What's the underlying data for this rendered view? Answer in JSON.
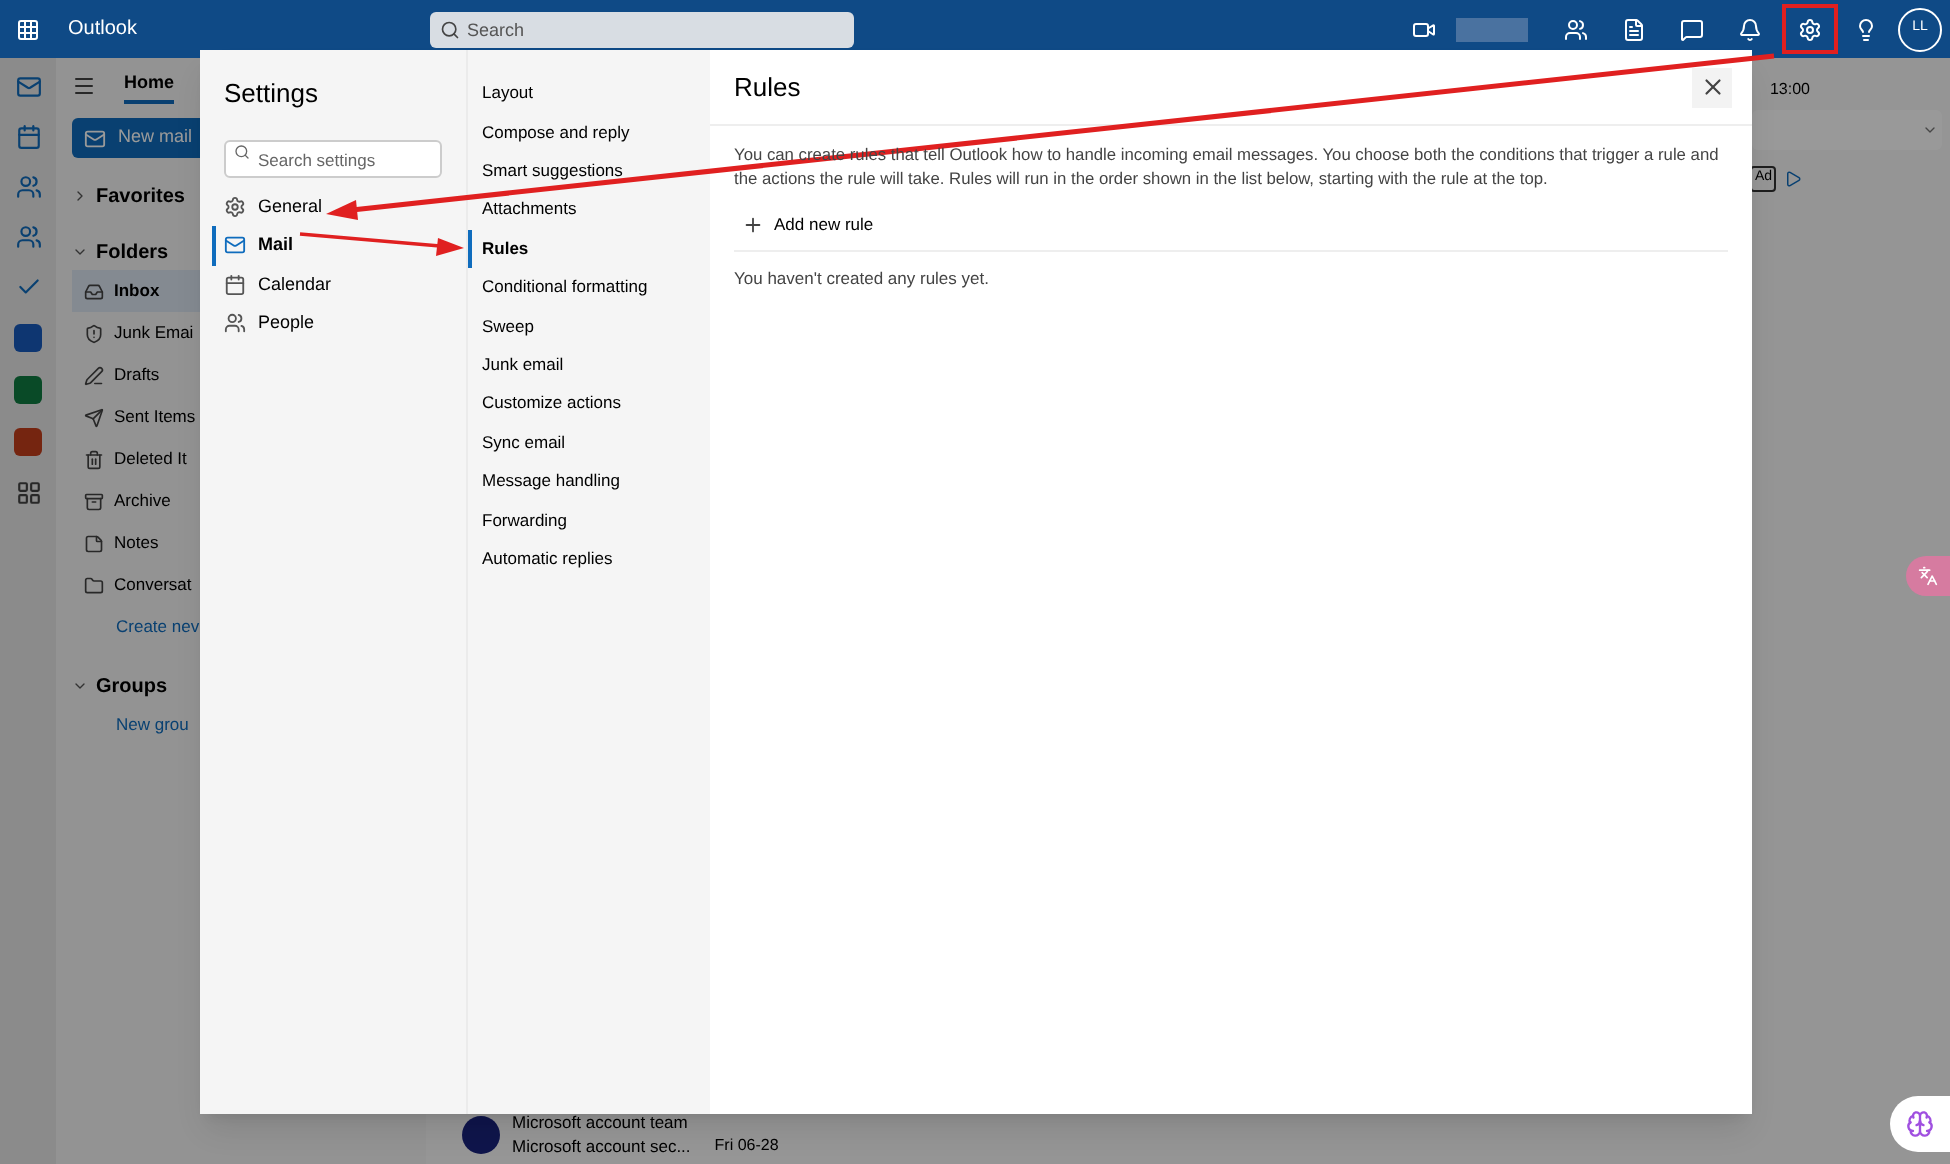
{
  "top_bar": {
    "app_name": "Outlook",
    "search": {
      "placeholder": "Search"
    },
    "avatar": "LL"
  },
  "ribbon": {
    "tabs": [
      {
        "label": "Home",
        "selected": true
      }
    ],
    "new_mail": "New mail"
  },
  "folder_pane": {
    "sections": [
      {
        "label": "Favorites",
        "expanded": false
      },
      {
        "label": "Folders",
        "expanded": true,
        "items": [
          {
            "label": "Inbox",
            "kind": "folder",
            "selected": true
          },
          {
            "label": "Junk Emai",
            "kind": "folder",
            "selected": false
          },
          {
            "label": "Drafts",
            "kind": "folder",
            "selected": false
          },
          {
            "label": "Sent Items",
            "kind": "folder",
            "selected": false
          },
          {
            "label": "Deleted It",
            "kind": "folder",
            "selected": false
          },
          {
            "label": "Archive",
            "kind": "folder",
            "selected": false
          },
          {
            "label": "Notes",
            "kind": "folder",
            "selected": false
          },
          {
            "label": "Conversat",
            "kind": "folder",
            "selected": false
          },
          {
            "label": "Create nev",
            "kind": "link"
          }
        ]
      },
      {
        "label": "Groups",
        "expanded": true,
        "items": [
          {
            "label": "New grou",
            "kind": "link"
          }
        ]
      }
    ]
  },
  "message_list": [
    {
      "sender": "Microsoft account team",
      "subject": "Microsoft account sec...",
      "date": "Fri 06-28"
    }
  ],
  "reading_pane": {
    "time": "13:00",
    "ad_badge": "Ad"
  },
  "settings": {
    "title": "Settings",
    "search": {
      "placeholder": "Search settings"
    },
    "categories": [
      {
        "label": "General",
        "selected": false
      },
      {
        "label": "Mail",
        "selected": true
      },
      {
        "label": "Calendar",
        "selected": false
      },
      {
        "label": "People",
        "selected": false
      }
    ],
    "subcategories": [
      {
        "label": "Layout",
        "selected": false
      },
      {
        "label": "Compose and reply",
        "selected": false
      },
      {
        "label": "Smart suggestions",
        "selected": false
      },
      {
        "label": "Attachments",
        "selected": false
      },
      {
        "label": "Rules",
        "selected": true
      },
      {
        "label": "Conditional formatting",
        "selected": false
      },
      {
        "label": "Sweep",
        "selected": false
      },
      {
        "label": "Junk email",
        "selected": false
      },
      {
        "label": "Customize actions",
        "selected": false
      },
      {
        "label": "Sync email",
        "selected": false
      },
      {
        "label": "Message handling",
        "selected": false
      },
      {
        "label": "Forwarding",
        "selected": false
      },
      {
        "label": "Automatic replies",
        "selected": false
      }
    ],
    "page": {
      "title": "Rules",
      "description": "You can create rules that tell Outlook how to handle incoming email messages. You choose both the conditions that trigger a rule and the actions the rule will take. Rules will run in the order shown in the list below, starting with the rule at the top.",
      "add_button": "Add new rule",
      "empty_message": "You haven't created any rules yet."
    }
  }
}
